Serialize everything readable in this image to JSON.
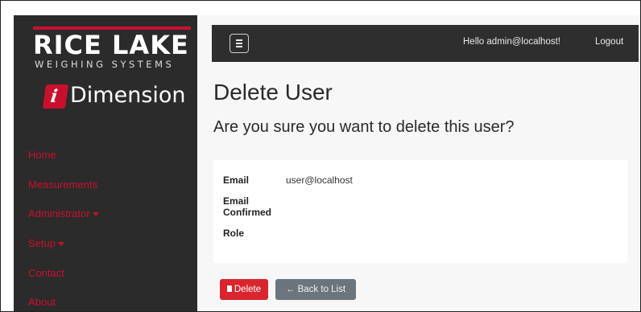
{
  "brand": {
    "company": "RICE LAKE",
    "tagline": "WEIGHING SYSTEMS",
    "product_icon_letter": "i",
    "product": "Dimension",
    "accent_color": "#c8102e"
  },
  "sidebar": {
    "items": [
      {
        "label": "Home",
        "has_caret": false
      },
      {
        "label": "Measurements",
        "has_caret": false
      },
      {
        "label": "Administrator",
        "has_caret": true
      },
      {
        "label": "Setup",
        "has_caret": true
      },
      {
        "label": "Contact",
        "has_caret": false
      },
      {
        "label": "About",
        "has_caret": false
      }
    ]
  },
  "topbar": {
    "menu_icon": "hamburger-icon",
    "greeting": "Hello admin@localhost!",
    "logout": "Logout"
  },
  "page": {
    "title": "Delete User",
    "confirm": "Are you sure you want to delete this user?"
  },
  "details": {
    "email_label": "Email",
    "email_value": "user@localhost",
    "confirmed_label_1": "Email",
    "confirmed_label_2": "Confirmed",
    "confirmed_value": "",
    "role_label": "Role",
    "role_value": ""
  },
  "actions": {
    "delete_label": "Delete",
    "delete_icon": "trash-icon",
    "back_label": "← Back to List",
    "delete_color": "#d9262e",
    "back_color": "#6c757d"
  }
}
